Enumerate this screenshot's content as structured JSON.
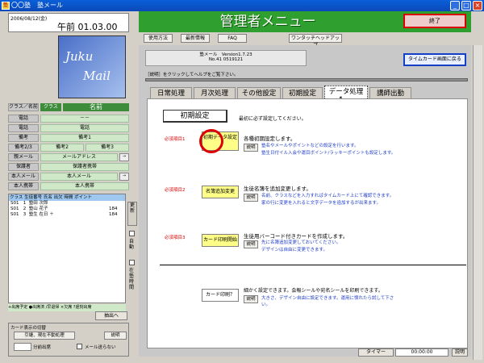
{
  "window": {
    "title": "〇〇塾　塾メール",
    "icon_text": "塾"
  },
  "clock": {
    "date": "2006/08/12(金)",
    "time": "午前 01.03.00"
  },
  "logo": {
    "line1": "Juku",
    "line2": "Mail"
  },
  "left_panel": {
    "class_header": {
      "label": "クラス／名前",
      "class": "クラス",
      "name": "名前"
    },
    "fields": [
      {
        "label": "電話",
        "value": "－－"
      },
      {
        "label": "電話",
        "value": "電話"
      },
      {
        "label": "備考",
        "value": "備考1"
      },
      {
        "label": "備考2/3",
        "value": "備考2",
        "value2": "備考3"
      },
      {
        "label": "親メール",
        "value": "メールアドレス"
      },
      {
        "label": "保護者",
        "value": "保護者携帯"
      },
      {
        "label": "本人メール",
        "value": "本人メール"
      },
      {
        "label": "本人携帯",
        "value": "本人携帯"
      }
    ],
    "list_header": "クラス 生徒番号 氏名 出欠 時間 ポイント",
    "students": [
      {
        "cls": "S01",
        "no": "1",
        "name": "塾田 次郎",
        "pt": ""
      },
      {
        "cls": "S01",
        "no": "2",
        "name": "塾山 花子",
        "pt": "184"
      },
      {
        "cls": "S01",
        "no": "3",
        "name": "塾生 在日 ＋",
        "pt": "184"
      }
    ],
    "vbtn_update": "更新",
    "auto_label": "自動",
    "session_label": "在塾時間",
    "legend": "+出席予定 ●出席済 /早退帰 ×欠席 ?遅刻出席",
    "extract_btn": "抽出へ",
    "bottom_caption": "カード表示の切替",
    "btn_switch": "引継、現在不動処理",
    "btn_explain": "説明",
    "delay_unit": "分前出席",
    "no_mail_label": "メール送らない"
  },
  "header": {
    "title": "管理者メニュー",
    "end_button": "終了",
    "top_buttons": [
      "使用方法",
      "最新情報",
      "FAQ",
      "ワンタッチヘッドアップ"
    ]
  },
  "version": {
    "line1": "塾メール　Version1.7.23",
    "line2": "No.41 0519121"
  },
  "return_button": "タイムカード画面に戻る",
  "help_hint": "［説明］をクリックしてヘルプをご覧下さい。",
  "tabs": [
    "日常処理",
    "月次処理",
    "その他設定",
    "初期設定",
    "データ処理",
    "講師出勤"
  ],
  "selected_tab": 4,
  "section": {
    "title": "初期設定",
    "desc": "最初に必ず設定してください。",
    "items": [
      {
        "req": "必須項目1",
        "button": "初期データ設定",
        "explain": "説明",
        "title": "各種初期設定します。",
        "lines": [
          "塾名やメールやポイントなどの設定を行います。",
          "塾生日付イル入会や運目ボイント/ラッキーポイントも設定します。"
        ]
      },
      {
        "req": "必須項目2",
        "button": "名簿追加変更",
        "explain": "説明",
        "title": "生徒名簿を追加変更します。",
        "lines": [
          "名前、クラスなどを入力すればタイムカード上にて確認できます。",
          "家の行に変更を入れると文字データを追加するが出来ます。"
        ]
      },
      {
        "req": "必須項目3",
        "button": "カード印刷開始",
        "explain": "説明",
        "title": "生徒用バーコード付きカードを作成します。",
        "lines": [
          "先に名簿追加変更しておいてください。",
          "デザインは自由に変更できます。"
        ]
      }
    ],
    "extra": {
      "button": "カード印刷？",
      "explain": "説明",
      "title": "細かく設定できます。会報シールや宛名シールを印刷できます。",
      "lines": [
        "大きさ、デザイン自由に設定できます。運用に慣れたら試して下さい。"
      ]
    }
  },
  "status": {
    "timer_label": "タイマー",
    "timer_value": "00:00:00",
    "explain": "説明"
  },
  "colors": {
    "header_green": "#2fa02f",
    "required_red": "#dd0000",
    "link_blue": "#1e3cc8",
    "button_yellow": "#ffff88"
  }
}
